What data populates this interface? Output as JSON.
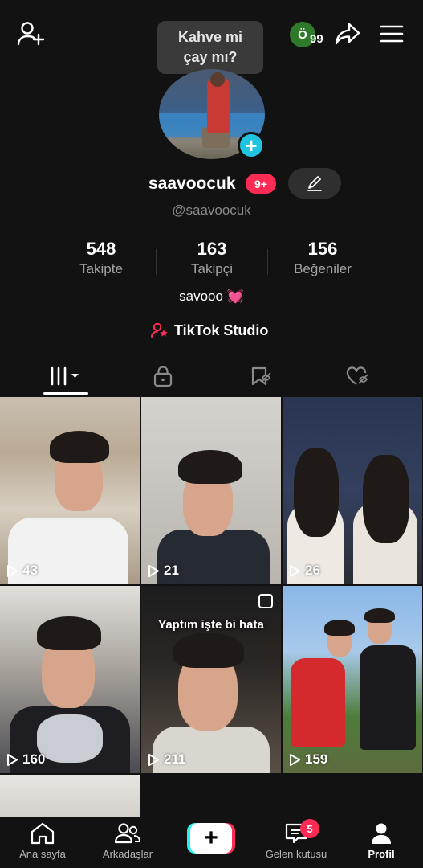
{
  "top_bar": {
    "add_friend_icon": "person-plus-icon",
    "profile_badge_letter": "Ö",
    "profile_badge_count": "99",
    "share_icon": "share-arrow-icon",
    "menu_icon": "hamburger-menu-icon"
  },
  "tooltip": {
    "text": "Kahve mi\nçay mı?"
  },
  "profile": {
    "username": "saavoocuk",
    "notification_badge": "9+",
    "handle": "@saavoocuk",
    "bio": "savooo",
    "bio_emoji": "💓",
    "studio_label": "TikTok Studio"
  },
  "stats": [
    {
      "value": "548",
      "label": "Takipte"
    },
    {
      "value": "163",
      "label": "Takipçi"
    },
    {
      "value": "156",
      "label": "Beğeniler"
    }
  ],
  "tabs": [
    {
      "icon": "videos-grid-icon",
      "active": true
    },
    {
      "icon": "lock-icon",
      "active": false
    },
    {
      "icon": "saved-icon",
      "active": false
    },
    {
      "icon": "liked-hidden-icon",
      "active": false
    }
  ],
  "videos": [
    {
      "views": "43"
    },
    {
      "views": "21"
    },
    {
      "views": "26"
    },
    {
      "views": "160"
    },
    {
      "views": "211",
      "caption": "Yaptım işte bi hata"
    },
    {
      "views": "159"
    }
  ],
  "bottom_nav": [
    {
      "label": "Ana sayfa",
      "icon": "home-icon"
    },
    {
      "label": "Arkadaşlar",
      "icon": "friends-icon"
    },
    {
      "label": "",
      "icon": "plus-icon"
    },
    {
      "label": "Gelen kutusu",
      "icon": "inbox-icon",
      "badge": "5"
    },
    {
      "label": "Profil",
      "icon": "profile-icon",
      "active": true
    }
  ],
  "colors": {
    "accent": "#fe2c55",
    "cyan": "#25f4ee",
    "background": "#121212"
  }
}
